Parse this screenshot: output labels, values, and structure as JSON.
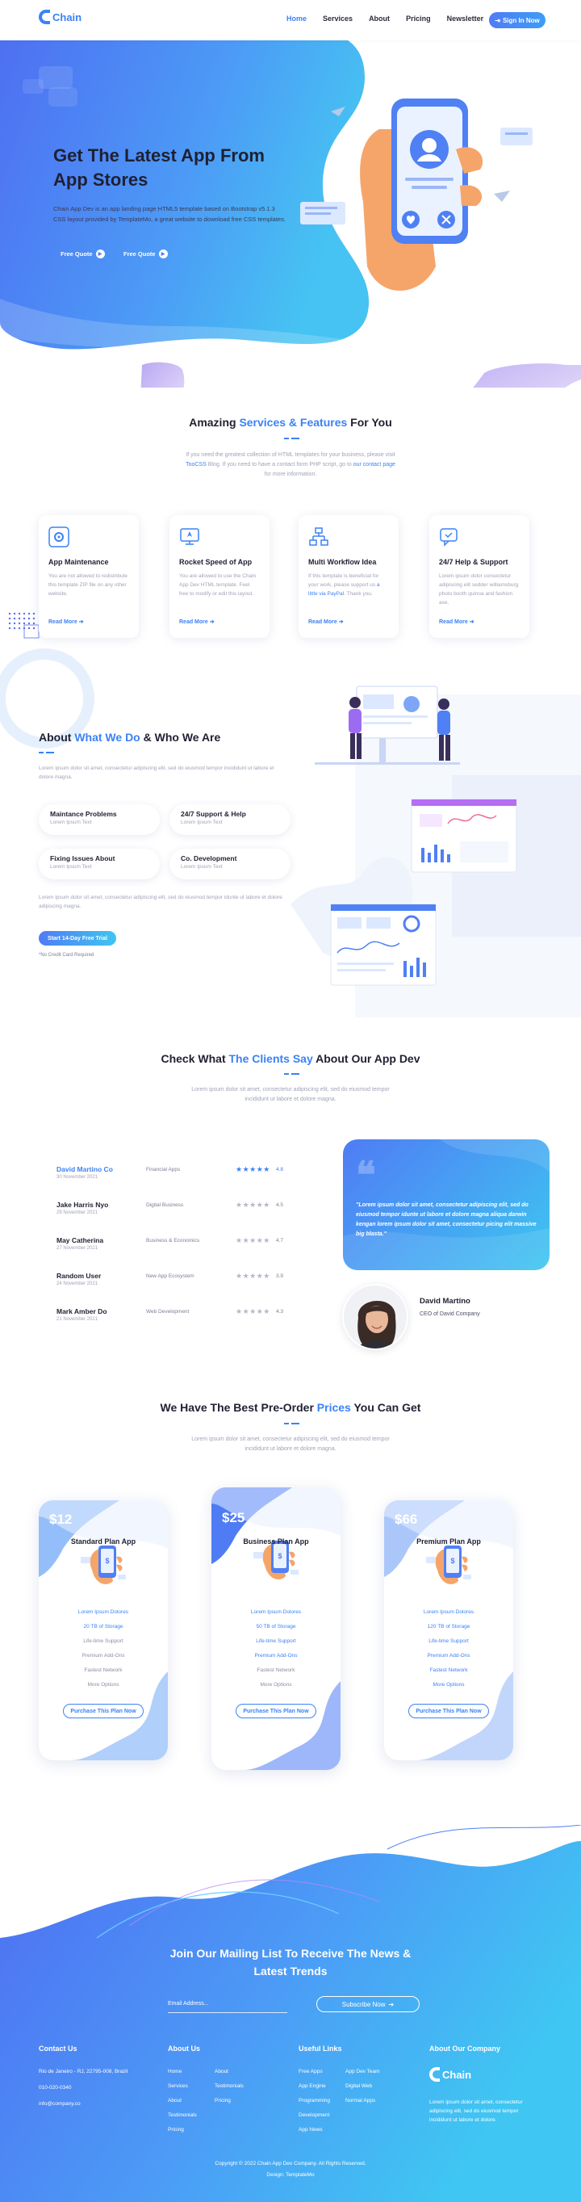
{
  "nav": {
    "brand": "Chain",
    "items": [
      {
        "label": "Home",
        "active": true
      },
      {
        "label": "Services",
        "active": false
      },
      {
        "label": "About",
        "active": false
      },
      {
        "label": "Pricing",
        "active": false
      },
      {
        "label": "Newsletter",
        "active": false
      }
    ],
    "signin": "Sign In Now"
  },
  "hero": {
    "title_line1": "Get The Latest App From",
    "title_line2": "App Stores",
    "desc": "Chain App Dev is an app landing page HTML5 template based on Bootstrap v5.1.3 CSS layout provided by TemplateMo, a great website to download free CSS templates.",
    "btn1": "Free Quote",
    "btn2": "Free Quote"
  },
  "services": {
    "title_pre": "Amazing ",
    "title_hl": "Services & Features",
    "title_post": " For You",
    "sub_a": "If you need the greatest collection of HTML templates for your business, please visit ",
    "sub_link1": "TooCSS",
    "sub_b": " Blog. If you need to have a contact form PHP script, go to ",
    "sub_link2": "our contact page",
    "sub_c": " for more information.",
    "cards": [
      {
        "title": "App Maintenance",
        "text": "You are not allowed to redistribute this template ZIP file on any other website.",
        "link": "Read More",
        "icon": "gear-icon"
      },
      {
        "title": "Rocket Speed of App",
        "text": "You are allowed to use the Chain App Dev HTML template. Feel free to modify or edit this layout.",
        "link": "Read More",
        "icon": "rocket-icon"
      },
      {
        "title": "Multi Workflow Idea",
        "text": "If this template is beneficial for your work, please support us ",
        "text_link": "a little via PayPal",
        "text_end": ". Thank you.",
        "link": "Read More",
        "icon": "workflow-icon"
      },
      {
        "title": "24/7 Help & Support",
        "text": "Lorem ipsum dolor consectetur adipiscing elit sedder williamsburg photo booth quinoa and fashion axe.",
        "link": "Read More",
        "icon": "support-icon"
      }
    ]
  },
  "about": {
    "title_pre": "About ",
    "title_hl": "What We Do",
    "title_post": " & Who We Are",
    "intro": "Lorem ipsum dolor sit amet, consectetur adipiscing elit, sed do eiusmod tempor incididunt ut labore et dolore magna.",
    "features": [
      {
        "title": "Maintance Problems",
        "sub": "Lorem Ipsum Text"
      },
      {
        "title": "24/7 Support & Help",
        "sub": "Lorem Ipsum Text"
      },
      {
        "title": "Fixing Issues About",
        "sub": "Lorem Ipsum Text"
      },
      {
        "title": "Co. Development",
        "sub": "Lorem Ipsum Text"
      }
    ],
    "outro": "Lorem ipsum dolor sit amet, consectetur adipiscing elit, sed do eiusmod tempor idunte ut labore et dolore adipiscing magna.",
    "cta": "Start 14-Day Free Trial",
    "note": "*No Credit Card Required"
  },
  "clients": {
    "title_pre": "Check What ",
    "title_hl": "The Clients Say",
    "title_post": " About Our App Dev",
    "sub": "Lorem ipsum dolor sit amet, consectetur adipiscing elit, sed do eiusmod tempor incididunt ut labore et dolore magna.",
    "rows": [
      {
        "name": "David Martino Co",
        "date": "30 November 2021",
        "category": "Financial Apps",
        "stars": "★★★★★",
        "score": "4.8",
        "active": true
      },
      {
        "name": "Jake Harris Nyo",
        "date": "29 November 2021",
        "category": "Digital Business",
        "stars": "★★★★★",
        "score": "4.5",
        "active": false
      },
      {
        "name": "May Catherina",
        "date": "27 November 2021",
        "category": "Business & Economics",
        "stars": "★★★★★",
        "score": "4.7",
        "active": false
      },
      {
        "name": "Random User",
        "date": "24 November 2021",
        "category": "New App Ecosystem",
        "stars": "★★★★★",
        "score": "3.9",
        "active": false
      },
      {
        "name": "Mark Amber Do",
        "date": "21 November 2021",
        "category": "Web Development",
        "stars": "★★★★★",
        "score": "4.3",
        "active": false
      }
    ],
    "quote": "\"Lorem ipsum dolor sit amet, consectetur adipiscing elit, sed do eiusmod tempor idunte ut labore et dolore magna aliqua darwin kengan lorem ipsum dolor sit amet, consectetur picing elit massive big blasta.\"",
    "person_name": "David Martino",
    "person_role": "CEO of David Company"
  },
  "pricing": {
    "title_pre": "We Have The Best Pre-Order ",
    "title_hl": "Prices",
    "title_post": " You Can Get",
    "sub": "Lorem ipsum dolor sit amet, consectetur adipiscing elit, sed do eiusmod tempor incididunt ut labore et dolore magna.",
    "plans": [
      {
        "price": "$12",
        "name": "Standard Plan App",
        "features": [
          "Lorem Ipsum Dolores",
          "20 TB of Storage",
          "Life-time Support",
          "Premium Add-Ons",
          "Fastest Network",
          "More Options"
        ],
        "active_count": 2,
        "button": "Purchase This Plan Now"
      },
      {
        "price": "$25",
        "name": "Business Plan App",
        "features": [
          "Lorem Ipsum Dolores",
          "50 TB of Storage",
          "Life-time Support",
          "Premium Add-Ons",
          "Fastest Network",
          "More Options"
        ],
        "active_count": 4,
        "button": "Purchase This Plan Now"
      },
      {
        "price": "$66",
        "name": "Premium Plan App",
        "features": [
          "Lorem Ipsum Dolores",
          "120 TB of Storage",
          "Life-time Support",
          "Premium Add-Ons",
          "Fastest Network",
          "More Options"
        ],
        "active_count": 6,
        "button": "Purchase This Plan Now"
      }
    ]
  },
  "footer": {
    "news_line1": "Join Our Mailing List To Receive The News &",
    "news_line2": "Latest Trends",
    "email_placeholder": "Email Address...",
    "subscribe": "Subscribe Now",
    "contact": {
      "title": "Contact Us",
      "address": "Rio de Janeiro - RJ, 22795-008, Brazil",
      "phone": "010-020-0340",
      "email": "info@company.co"
    },
    "about": {
      "title": "About Us",
      "col1": [
        "Home",
        "Services",
        "About",
        "Testimonials",
        "Pricing"
      ],
      "col2": [
        "About",
        "Testimonials",
        "Pricing"
      ]
    },
    "useful": {
      "title": "Useful Links",
      "col1": [
        "Free Apps",
        "App Engine",
        "Programming",
        "Development",
        "App News"
      ],
      "col2": [
        "App Dev Team",
        "Digital Web",
        "Normal Apps"
      ]
    },
    "company": {
      "title": "About Our Company",
      "brand": "Chain",
      "text": "Lorem ipsum dolor sit amet, consectetur adipiscing elit, sed do eiusmod tempor incididunt ut labore et dolore."
    },
    "copyright": "Copyright © 2022 Chain App Dev Company. All Rights Reserved.",
    "design": "Design: TemplateMo"
  }
}
